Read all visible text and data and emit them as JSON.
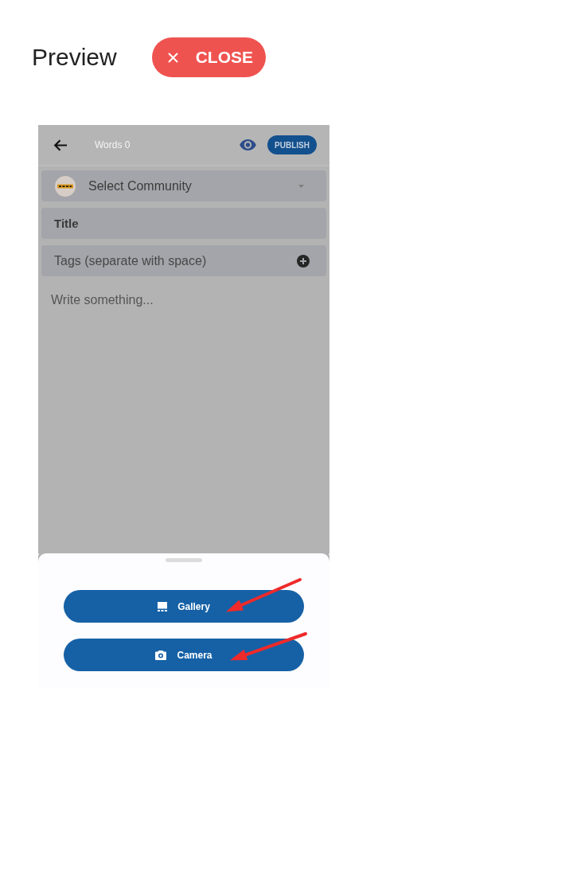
{
  "header": {
    "title": "Preview",
    "close_button": {
      "label": "CLOSE"
    }
  },
  "preview_screen": {
    "app_bar": {
      "word_count": "Words 0",
      "publish_button": {
        "label": "PUBLISH"
      }
    },
    "form": {
      "community_select": {
        "placeholder": "Select Community"
      },
      "title_field": {
        "placeholder": "Title"
      },
      "tags_field": {
        "placeholder": "Tags (separate with space)"
      },
      "body_field": {
        "placeholder": "Write something..."
      }
    },
    "bottom_sheet": {
      "actions": [
        {
          "kind": "gallery",
          "label": "Gallery",
          "pointed_at": true
        },
        {
          "kind": "camera",
          "label": "Camera",
          "pointed_at": true
        }
      ]
    }
  }
}
